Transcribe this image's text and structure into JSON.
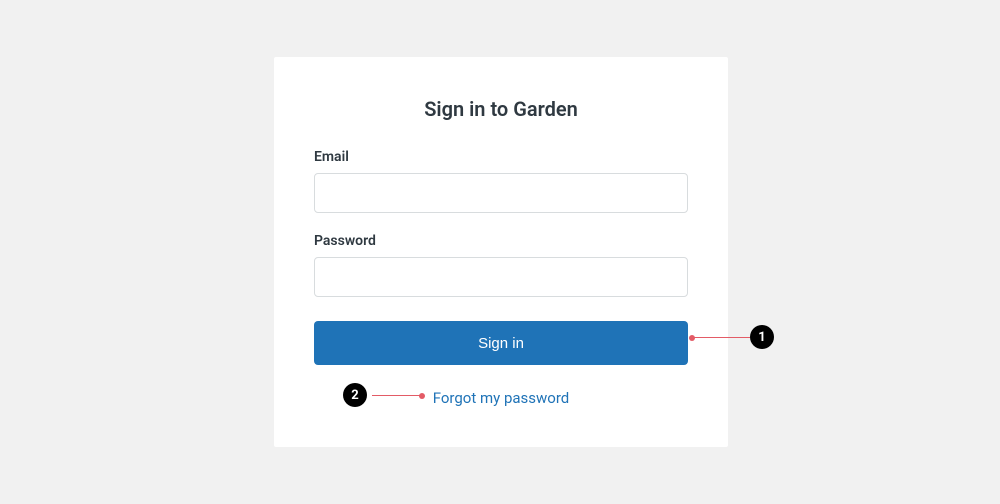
{
  "title": "Sign in to Garden",
  "fields": {
    "email": {
      "label": "Email",
      "value": ""
    },
    "password": {
      "label": "Password",
      "value": ""
    }
  },
  "buttons": {
    "signin": "Sign in"
  },
  "links": {
    "forgot": "Forgot my password"
  },
  "annotations": {
    "one": "1",
    "two": "2"
  }
}
